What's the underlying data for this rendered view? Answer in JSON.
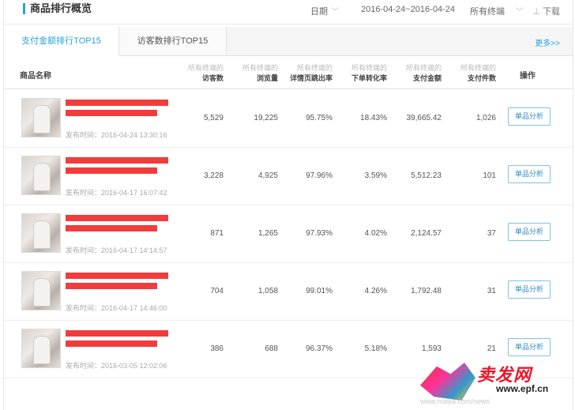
{
  "header": {
    "title": "商品排行概览",
    "date_label": "日期",
    "date_range": "2016-04-24~2016-04-24",
    "terminal": "所有终端",
    "download": "下载"
  },
  "tabs": [
    {
      "label": "支付金额排行TOP15",
      "active": true
    },
    {
      "label": "访客数排行TOP15",
      "active": false
    }
  ],
  "more": "更多>>",
  "columns": {
    "name": "商品名称",
    "terminal_prefix": "所有终端的",
    "visitors": "访客数",
    "pageviews": "浏览量",
    "bounce": "详情页跳出率",
    "conversion": "下单转化率",
    "pay_amount": "支付金额",
    "pay_count": "支付件数",
    "action": "操作"
  },
  "rows": [
    {
      "published": "发布时间：2016-04-24 13:30:16",
      "visitors": "5,529",
      "pageviews": "19,225",
      "bounce": "95.75%",
      "conversion": "18.43%",
      "pay_amount": "39,665.42",
      "pay_count": "1,026",
      "action": "单品分析"
    },
    {
      "published": "发布时间：2016-04-17 16:07:42",
      "visitors": "3,228",
      "pageviews": "4,925",
      "bounce": "97.96%",
      "conversion": "3.59%",
      "pay_amount": "5,512.23",
      "pay_count": "101",
      "action": "单品分析"
    },
    {
      "published": "发布时间：2016-04-17 14:14:57",
      "visitors": "871",
      "pageviews": "1,265",
      "bounce": "97.93%",
      "conversion": "4.02%",
      "pay_amount": "2,124.57",
      "pay_count": "37",
      "action": "单品分析"
    },
    {
      "published": "发布时间：2016-04-17 14:46:00",
      "visitors": "704",
      "pageviews": "1,058",
      "bounce": "99.01%",
      "conversion": "4.26%",
      "pay_amount": "1,792.48",
      "pay_count": "31",
      "action": "单品分析"
    },
    {
      "published": "发布时间：2016-03-05 12:02:06",
      "visitors": "386",
      "pageviews": "688",
      "bounce": "96.37%",
      "conversion": "5.18%",
      "pay_amount": "1,593",
      "pay_count": "21",
      "action": "单品分析"
    }
  ],
  "watermark": {
    "brand": "卖发网",
    "site": "www.epf.cn",
    "url": "www.maijia.com/news"
  },
  "colors": {
    "accent": "#2aa3d8",
    "redacted": "#f23c3c"
  }
}
